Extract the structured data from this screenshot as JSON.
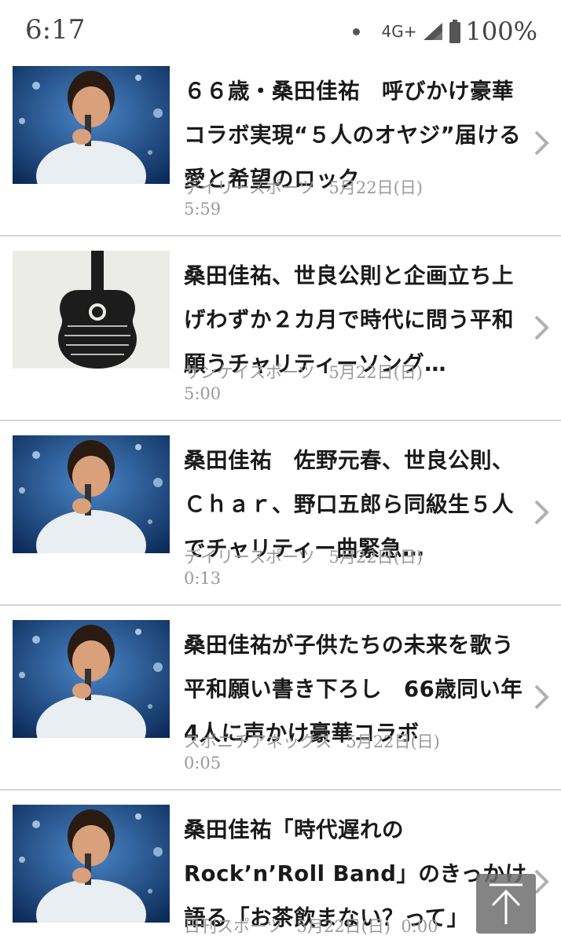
{
  "status": {
    "time": "6:17",
    "network": "4G+",
    "battery": "100%"
  },
  "items": [
    {
      "title": "６６歳・桑田佳祐　呼びかけ豪華コラボ実現“５人のオヤジ”届ける愛と希望のロック",
      "source": "デイリースポーツ",
      "date": "5月22日(日)",
      "time": "5:59",
      "thumb": "singer-photo"
    },
    {
      "title": "桑田佳祐、世良公則と企画立ち上げわずか２カ月で時代に問う平和願うチャリティーソング…",
      "source": "サンケイスポーツ",
      "date": "5月22日(日)",
      "time": "5:00",
      "thumb": "guitar-logo"
    },
    {
      "title": "桑田佳祐　佐野元春、世良公則、Ｃｈａｒ、野口五郎ら同級生５人でチャリティー曲緊急…",
      "source": "デイリースポーツ",
      "date": "5月22日(日)",
      "time": "0:13",
      "thumb": "singer-photo"
    },
    {
      "title": "桑田佳祐が子供たちの未来を歌う　平和願い書き下ろし　66歳同い年4人に声かけ豪華コラボ",
      "source": "スポニチアネックス",
      "date": "5月22日(日)",
      "time": "0:05",
      "thumb": "singer-photo"
    },
    {
      "title": "桑田佳祐「時代遅れのRock’n’Roll Band」のきっかけ語る「お茶飲まない？って」",
      "source": "日刊スポーツ",
      "date": "5月22日(日)",
      "time": "0:00",
      "thumb": "singer-photo"
    }
  ],
  "icons": {
    "chevron": "chevron-right-icon",
    "scroll_top": "arrow-up-icon"
  },
  "colors": {
    "title": "#1a1a1a",
    "meta": "#9a9a9a",
    "divider": "#d6d6d6"
  }
}
